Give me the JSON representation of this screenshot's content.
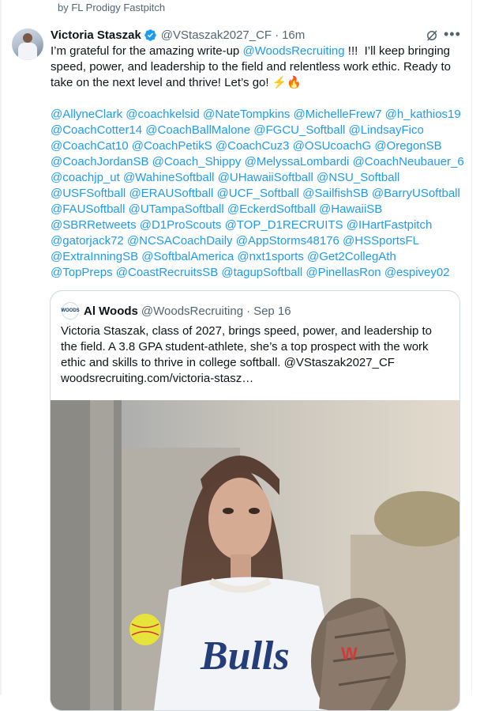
{
  "context_line": "by FL Prodigy Fastpitch",
  "tweet": {
    "display_name": "Victoria Staszak",
    "handle": "@VStaszak2027_CF",
    "separator": "·",
    "time": "16m",
    "text_before_link": "I’m grateful for the amazing write-up ",
    "text_link": "@WoodsRecruiting",
    "text_after_link": " !!!  I’ll keep bringing speed, power, and leadership to the field and relentless work ethic. Ready to take on the next level and thrive! Let’s go! ⚡🔥",
    "mention_lines": [
      [
        "@AllyneClark",
        "@coachkelsid",
        "@NateTompkins",
        "@MichelleFrew7",
        "@h_kathios19"
      ],
      [
        "@CoachCotter14",
        "@CoachBallMalone",
        "@FGCU_Softball",
        "@LindsayFico"
      ],
      [
        "@CoachCat10",
        "@CoachPetikS",
        "@CoachCuz3",
        "@OSUcoachG",
        "@OregonSB"
      ],
      [
        "@CoachJordanSB",
        "@Coach_Shippy",
        "@MelyssaLombardi",
        "@CoachNeubauer_6"
      ],
      [
        "@coachjp_ut",
        "@WahineSoftball",
        "@UHawaiiSoftball",
        "@NSU_Softball"
      ],
      [
        "@USFSoftball",
        "@ERAUSoftball",
        "@UCF_Softball",
        "@SailfishSB",
        "@BarryUSoftball"
      ],
      [
        "@FAUSoftball",
        "@UTampaSoftball",
        "@EckerdSoftball",
        "@HawaiiSB"
      ],
      [
        "@SBRRetweets",
        "@D1ProScouts",
        "@TOP_D1RECRUITS",
        "@IHartFastpitch"
      ],
      [
        "@gatorjack72",
        "@NCSACoachDaily",
        "@AppStorms48176",
        "@HSSportsFL"
      ],
      [
        "@ExtraInningSB",
        "@SoftbalAmerica",
        "@nxt1sports",
        "@Get2CollegAth"
      ],
      [
        "@TopPreps",
        "@CoastRecruitsSB",
        "@tagupSoftball",
        "@PinellasRon",
        "@espivey02"
      ]
    ]
  },
  "quote": {
    "avatar_text": "WOODS",
    "display_name": "Al Woods",
    "handle": "@WoodsRecruiting",
    "separator": "·",
    "date": "Sep 16",
    "text_line_1": "Victoria Staszak, class of 2027, brings speed, power, and leadership to the field. A 3.8 GPA student-athlete, she’s a top prospect with the work ethic and skills to thrive in college softball. ",
    "text_mention": "@VStaszak2027_CF",
    "text_url": "woodsrecruiting.com/victoria-stasz…",
    "jersey_text": "Bulls"
  },
  "icons": {
    "verified": "verified-badge-icon",
    "grok": "grok-icon",
    "more": "more-icon",
    "glove_logo": "W"
  },
  "colors": {
    "link": "#1d9bf0",
    "secondary_text": "#536471",
    "verified": "#1d9bf0"
  }
}
